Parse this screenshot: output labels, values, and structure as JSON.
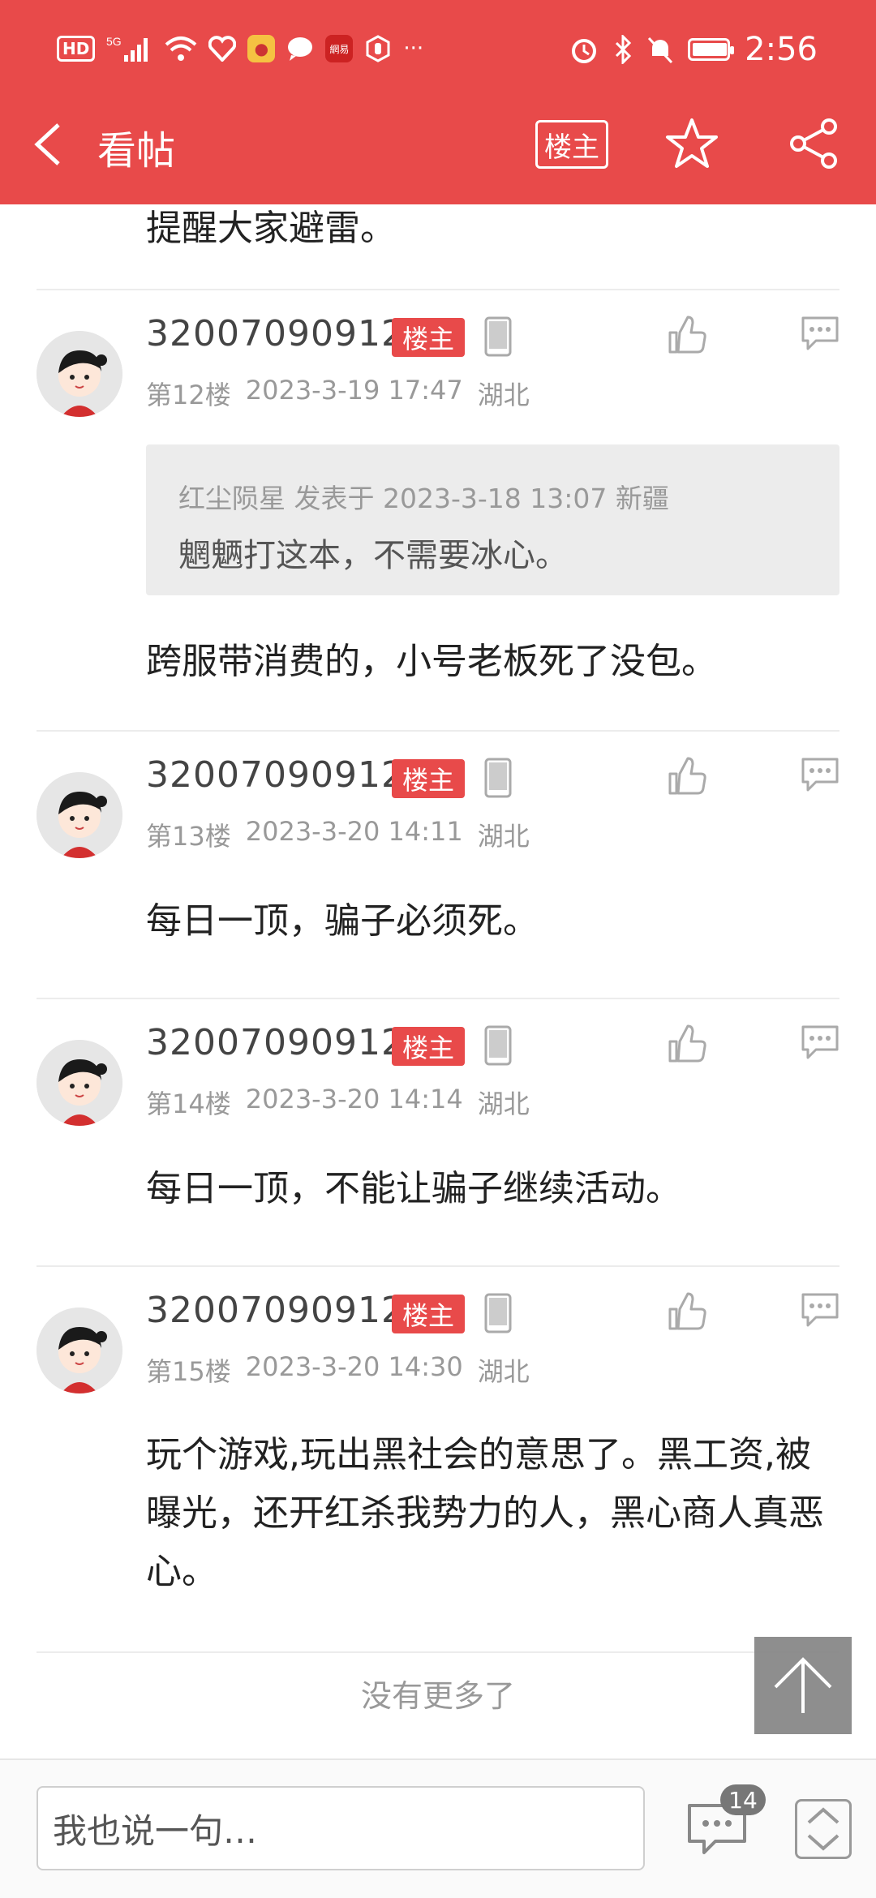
{
  "status_bar": {
    "hd": "HD",
    "network": "5G",
    "more": "···",
    "time": "2:56"
  },
  "nav": {
    "title": "看帖",
    "owner_only": "楼主"
  },
  "prev_post_tail": "提醒大家避雷。",
  "posts": [
    {
      "username": "320070909121",
      "owner_tag": "楼主",
      "floor": "第12楼",
      "time": "2023-3-19 17:47",
      "location": "湖北",
      "quote": {
        "meta": "红尘陨星 发表于 2023-3-18 13:07 新疆",
        "text": "魍魉打这本，不需要冰心。"
      },
      "text": "跨服带消费的，小号老板死了没包。"
    },
    {
      "username": "320070909121",
      "owner_tag": "楼主",
      "floor": "第13楼",
      "time": "2023-3-20 14:11",
      "location": "湖北",
      "text": "每日一顶，骗子必须死。"
    },
    {
      "username": "320070909121",
      "owner_tag": "楼主",
      "floor": "第14楼",
      "time": "2023-3-20 14:14",
      "location": "湖北",
      "text": "每日一顶，不能让骗子继续活动。"
    },
    {
      "username": "320070909121",
      "owner_tag": "楼主",
      "floor": "第15楼",
      "time": "2023-3-20 14:30",
      "location": "湖北",
      "text": "玩个游戏,玩出黑社会的意思了。黑工资,被曝光，还开红杀我势力的人，黑心商人真恶心。"
    }
  ],
  "no_more": "没有更多了",
  "bottom": {
    "input_placeholder": "我也说一句…",
    "comment_count": "14"
  },
  "colors": {
    "brand": "#e84a4a",
    "muted": "#999999"
  }
}
